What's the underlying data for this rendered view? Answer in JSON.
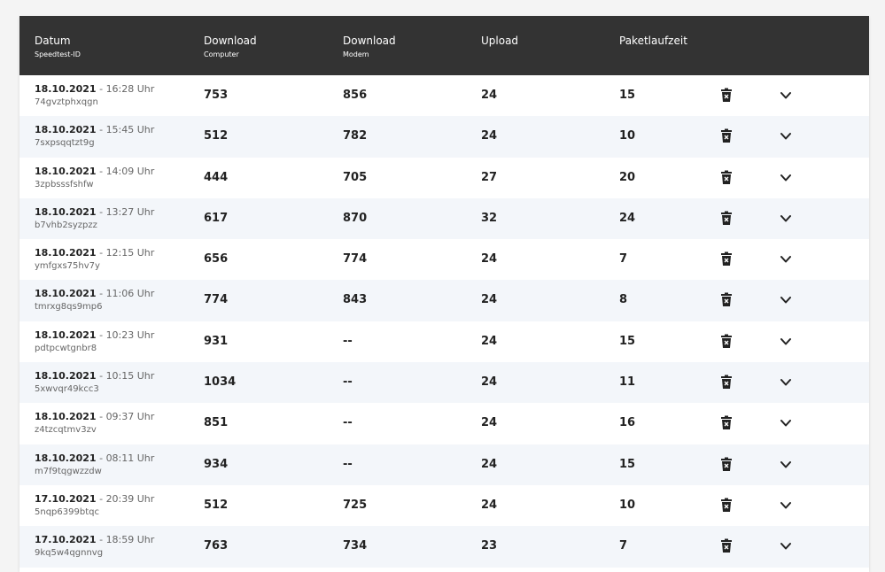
{
  "header": {
    "datum": "Datum",
    "datum_sub": "Speedtest-ID",
    "dl_computer": "Download",
    "dl_computer_sub": "Computer",
    "dl_modem": "Download",
    "dl_modem_sub": "Modem",
    "upload": "Upload",
    "paketlaufzeit": "Paketlaufzeit"
  },
  "rows": [
    {
      "date": "18.10.2021",
      "sep": " - ",
      "time": "16:28 Uhr",
      "id": "74gvztphxqgn",
      "dl_computer": "753",
      "dl_modem": "856",
      "upload": "24",
      "paket": "15"
    },
    {
      "date": "18.10.2021",
      "sep": " - ",
      "time": "15:45 Uhr",
      "id": "7sxpsqqtzt9g",
      "dl_computer": "512",
      "dl_modem": "782",
      "upload": "24",
      "paket": "10"
    },
    {
      "date": "18.10.2021",
      "sep": " - ",
      "time": "14:09 Uhr",
      "id": "3zpbsssfshfw",
      "dl_computer": "444",
      "dl_modem": "705",
      "upload": "27",
      "paket": "20"
    },
    {
      "date": "18.10.2021",
      "sep": " - ",
      "time": "13:27 Uhr",
      "id": "b7vhb2syzpzz",
      "dl_computer": "617",
      "dl_modem": "870",
      "upload": "32",
      "paket": "24"
    },
    {
      "date": "18.10.2021",
      "sep": " - ",
      "time": "12:15 Uhr",
      "id": "ymfgxs75hv7y",
      "dl_computer": "656",
      "dl_modem": "774",
      "upload": "24",
      "paket": "7"
    },
    {
      "date": "18.10.2021",
      "sep": " - ",
      "time": "11:06 Uhr",
      "id": "tmrxg8qs9mp6",
      "dl_computer": "774",
      "dl_modem": "843",
      "upload": "24",
      "paket": "8"
    },
    {
      "date": "18.10.2021",
      "sep": " - ",
      "time": "10:23 Uhr",
      "id": "pdtpcwtgnbr8",
      "dl_computer": "931",
      "dl_modem": "--",
      "upload": "24",
      "paket": "15"
    },
    {
      "date": "18.10.2021",
      "sep": " - ",
      "time": "10:15 Uhr",
      "id": "5xwvqr49kcc3",
      "dl_computer": "1034",
      "dl_modem": "--",
      "upload": "24",
      "paket": "11"
    },
    {
      "date": "18.10.2021",
      "sep": " - ",
      "time": "09:37 Uhr",
      "id": "z4tzcqtmv3zv",
      "dl_computer": "851",
      "dl_modem": "--",
      "upload": "24",
      "paket": "16"
    },
    {
      "date": "18.10.2021",
      "sep": " - ",
      "time": "08:11 Uhr",
      "id": "m7f9tqgwzzdw",
      "dl_computer": "934",
      "dl_modem": "--",
      "upload": "24",
      "paket": "15"
    },
    {
      "date": "17.10.2021",
      "sep": " - ",
      "time": "20:39 Uhr",
      "id": "5nqp6399btqc",
      "dl_computer": "512",
      "dl_modem": "725",
      "upload": "24",
      "paket": "10"
    },
    {
      "date": "17.10.2021",
      "sep": " - ",
      "time": "18:59 Uhr",
      "id": "9kq5w4qgnnvg",
      "dl_computer": "763",
      "dl_modem": "734",
      "upload": "23",
      "paket": "7"
    }
  ],
  "icons": {
    "delete": "trash-icon",
    "expand": "chevron-down-icon"
  },
  "colors": {
    "header_bg": "#333333",
    "row_alt": "#f3f6fa",
    "page_bg": "#f4f4f4"
  }
}
